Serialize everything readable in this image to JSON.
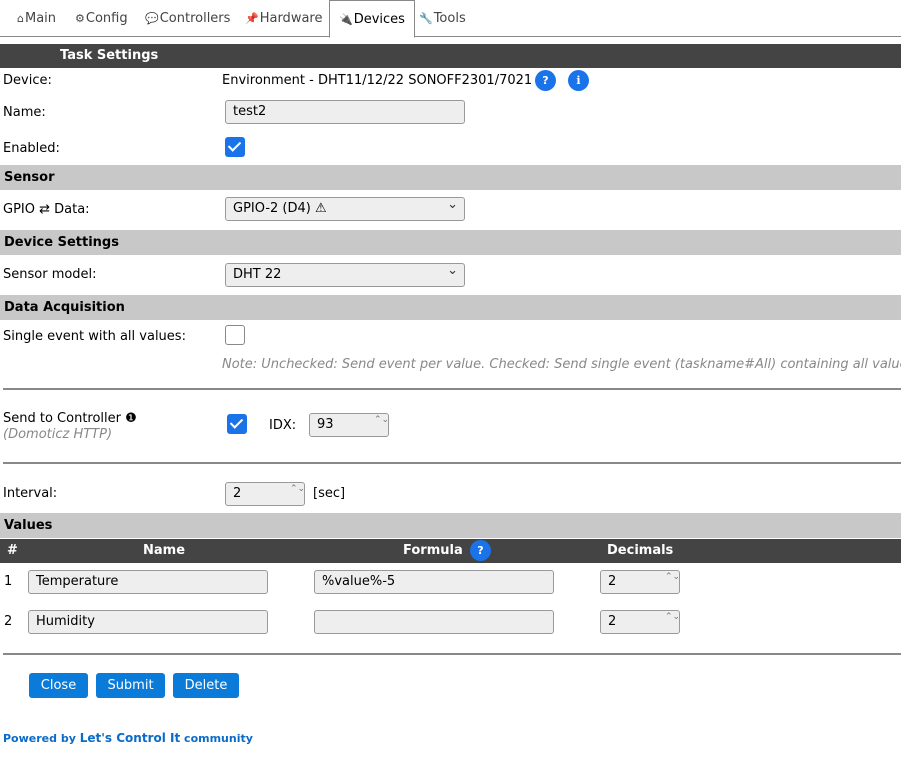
{
  "tabs": [
    {
      "icon": "⌂",
      "label": "Main"
    },
    {
      "icon": "⚙",
      "label": "Config"
    },
    {
      "icon": "💬",
      "label": "Controllers"
    },
    {
      "icon": "📌",
      "label": "Hardware"
    },
    {
      "icon": "🔌",
      "label": "Devices"
    },
    {
      "icon": "🔧",
      "label": "Tools"
    }
  ],
  "task_settings": {
    "header": "Task Settings",
    "device_label": "Device:",
    "device_value": "Environment - DHT11/12/22 SONOFF2301/7021",
    "help_q": "?",
    "help_i": "i",
    "name_label": "Name:",
    "name_value": "test2",
    "enabled_label": "Enabled:",
    "enabled": true
  },
  "sensor": {
    "header": "Sensor",
    "gpio_label": "GPIO ⇄ Data:",
    "gpio_value": "GPIO-2 (D4) ⚠"
  },
  "device_settings": {
    "header": "Device Settings",
    "model_label": "Sensor model:",
    "model_value": "DHT 22"
  },
  "data_acquisition": {
    "header": "Data Acquisition",
    "single_event_label": "Single event with all values:",
    "single_event": false,
    "note": "Note: Unchecked: Send event per value. Checked: Send single event (taskname#All) containing all values",
    "send_label": "Send to Controller",
    "send_badge": "❶",
    "send_sub": "(Domoticz HTTP)",
    "send_checked": true,
    "idx_label": "IDX:",
    "idx_value": "93",
    "interval_label": "Interval:",
    "interval_value": "2",
    "interval_unit": "[sec]"
  },
  "values": {
    "header": "Values",
    "col_num": "#",
    "col_name": "Name",
    "col_formula": "Formula",
    "col_decimals": "Decimals",
    "rows": [
      {
        "num": "1",
        "name": "Temperature",
        "formula": "%value%-5",
        "decimals": "2"
      },
      {
        "num": "2",
        "name": "Humidity",
        "formula": "",
        "decimals": "2"
      }
    ]
  },
  "buttons": {
    "close": "Close",
    "submit": "Submit",
    "delete": "Delete"
  },
  "footer": {
    "prefix": "Powered by ",
    "link": "Let's Control It",
    "suffix": " community"
  },
  "colors": {
    "accent": "#1a73e8",
    "button": "#0a7bd8",
    "header_dark": "#444444",
    "header_gray": "#c8c8c8",
    "footer_link": "#0a6cc8"
  }
}
